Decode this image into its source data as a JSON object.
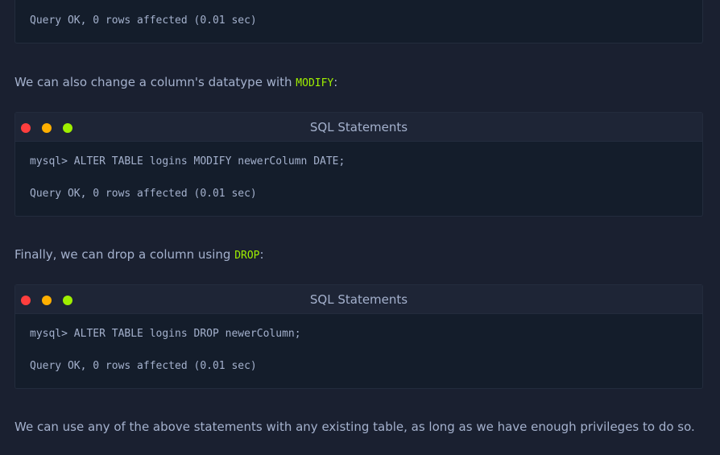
{
  "top_block": {
    "output": "Query OK, 0 rows affected (0.01 sec)"
  },
  "para_modify": {
    "text_before": "We can also change a column's datatype with ",
    "keyword": "MODIFY",
    "text_after": ":"
  },
  "block_modify": {
    "title": "SQL Statements",
    "command": "mysql> ALTER TABLE logins MODIFY newerColumn DATE;",
    "output": "Query OK, 0 rows affected (0.01 sec)"
  },
  "para_drop": {
    "text_before": "Finally, we can drop a column using ",
    "keyword": "DROP",
    "text_after": ":"
  },
  "block_drop": {
    "title": "SQL Statements",
    "command": "mysql> ALTER TABLE logins DROP newerColumn;",
    "output": "Query OK, 0 rows affected (0.01 sec)"
  },
  "para_final": {
    "text": "We can use any of the above statements with any existing table, as long as we have enough privileges to do so."
  },
  "colors": {
    "background": "#1a2030",
    "code_background": "#141d2b",
    "accent_green": "#9fef00",
    "dot_red": "#ff3e3e",
    "dot_yellow": "#ffaf00",
    "dot_green": "#9fef00"
  }
}
